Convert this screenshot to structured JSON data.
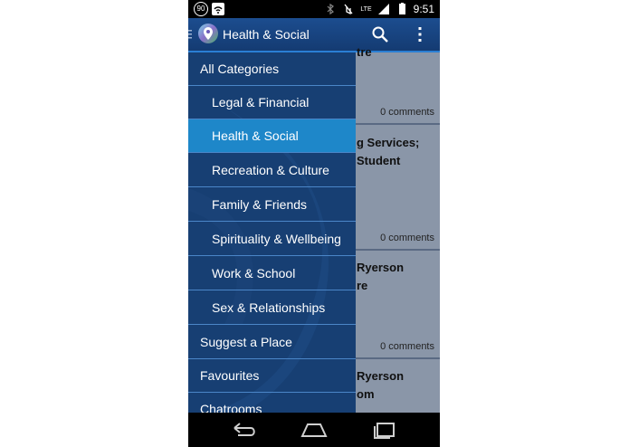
{
  "status_bar": {
    "notification_badge": "90",
    "time": "9:51",
    "network": "LTE",
    "icons": [
      "wifi-icon",
      "bluetooth-icon",
      "mute-icon",
      "signal-icon",
      "battery-icon"
    ]
  },
  "action_bar": {
    "title": "Health & Social",
    "icons": [
      "drawer-indicator-icon",
      "app-logo-icon",
      "search-icon",
      "overflow-menu-icon"
    ]
  },
  "drawer": {
    "items": [
      {
        "label": "All Categories",
        "level": "top",
        "selected": false
      },
      {
        "label": "Legal & Financial",
        "level": "sub",
        "selected": false
      },
      {
        "label": "Health & Social",
        "level": "sub",
        "selected": true
      },
      {
        "label": "Recreation & Culture",
        "level": "sub",
        "selected": false
      },
      {
        "label": "Family & Friends",
        "level": "sub",
        "selected": false
      },
      {
        "label": "Spirituality & Wellbeing",
        "level": "sub",
        "selected": false
      },
      {
        "label": "Work & School",
        "level": "sub",
        "selected": false
      },
      {
        "label": "Sex & Relationships",
        "level": "sub",
        "selected": false
      },
      {
        "label": "Suggest a Place",
        "level": "top",
        "selected": false
      },
      {
        "label": "Favourites",
        "level": "top",
        "selected": false
      },
      {
        "label": "Chatrooms",
        "level": "top",
        "selected": false
      }
    ]
  },
  "background_cards": [
    {
      "title": "tre",
      "comments": "0 comments"
    },
    {
      "title": "g Services;\nStudent",
      "comments": "0 comments"
    },
    {
      "title": "Ryerson\nre",
      "comments": "0 comments"
    },
    {
      "title": "Ryerson\nom",
      "comments": ""
    }
  ],
  "nav_bar": {
    "icons": [
      "back-icon",
      "home-icon",
      "recent-apps-icon"
    ]
  },
  "colors": {
    "action_bar": "#1c4d8f",
    "drawer": "#173f73",
    "selected": "#1e87c9",
    "divider": "#4b86c8"
  }
}
